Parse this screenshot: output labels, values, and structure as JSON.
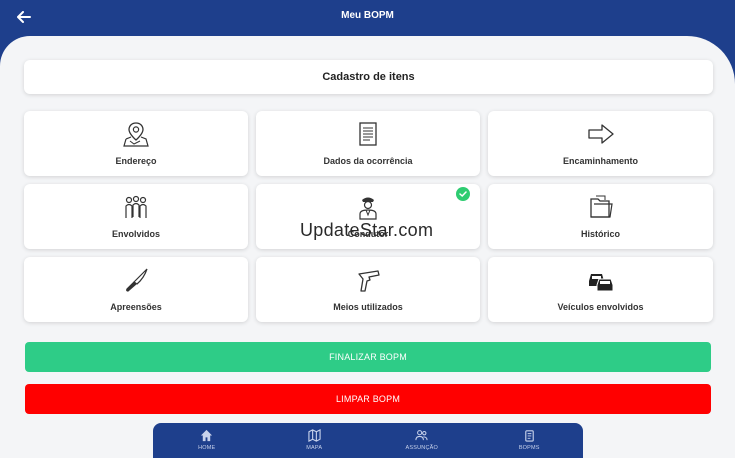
{
  "header": {
    "title": "Meu BOPM"
  },
  "section": {
    "title": "Cadastro de itens"
  },
  "tiles": [
    {
      "label": "Endereço",
      "icon": "map-pin-icon",
      "completed": false
    },
    {
      "label": "Dados da ocorrência",
      "icon": "document-icon",
      "completed": false
    },
    {
      "label": "Encaminhamento",
      "icon": "arrow-right-icon",
      "completed": false
    },
    {
      "label": "Envolvidos",
      "icon": "people-group-icon",
      "completed": false
    },
    {
      "label": "Condutor",
      "icon": "police-officer-icon",
      "completed": true
    },
    {
      "label": "Histórico",
      "icon": "folder-icon",
      "completed": false
    },
    {
      "label": "Apreensões",
      "icon": "knife-icon",
      "completed": false
    },
    {
      "label": "Meios utilizados",
      "icon": "gun-icon",
      "completed": false
    },
    {
      "label": "Veículos envolvidos",
      "icon": "cars-icon",
      "completed": false
    }
  ],
  "actions": {
    "finalize_label": "FINALIZAR BOPM",
    "clear_label": "LIMPAR BOPM"
  },
  "watermark": "UpdateStar.com",
  "nav": [
    {
      "label": "HOME",
      "icon": "home-icon"
    },
    {
      "label": "MAPA",
      "icon": "map-icon"
    },
    {
      "label": "ASSUNÇÃO",
      "icon": "users-icon"
    },
    {
      "label": "BOPMS",
      "icon": "clipboard-icon"
    }
  ],
  "colors": {
    "primary": "#1e3f8c",
    "success": "#2ecc87",
    "danger": "#ff0000",
    "check": "#2ecc71"
  }
}
